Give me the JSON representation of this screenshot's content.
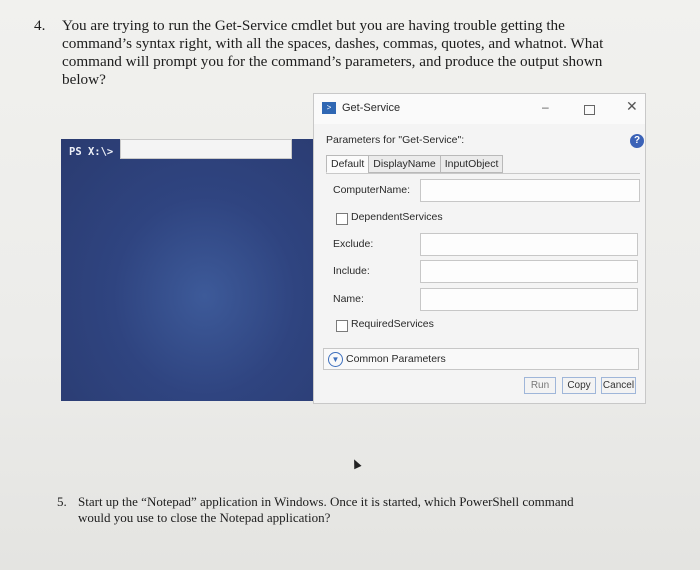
{
  "question4": {
    "number": "4.",
    "text": "You are trying to run the Get-Service cmdlet but you are having trouble getting the command’s syntax right, with all the spaces, dashes, commas, quotes, and whatnot. What command will prompt you for the command’s parameters, and produce the output shown below?"
  },
  "console": {
    "prompt": "PS X:\\>"
  },
  "dialog": {
    "title": "Get-Service",
    "params_heading": "Parameters for \"Get-Service\":",
    "help": "?",
    "tabs": [
      {
        "label": "Default"
      },
      {
        "label": "DisplayName"
      },
      {
        "label": "InputObject"
      }
    ],
    "fields": {
      "computer_name": "ComputerName:",
      "dependent_services": "DependentServices",
      "exclude": "Exclude:",
      "include": "Include:",
      "name": "Name:",
      "required_services": "RequiredServices"
    },
    "common_parameters": "Common Parameters",
    "buttons": {
      "run": "Run",
      "copy": "Copy",
      "cancel": "Cancel"
    },
    "window_controls": {
      "minimize": "–",
      "maximize": "",
      "close": "✕"
    }
  },
  "question5": {
    "number": "5.",
    "text": "Start up the “Notepad” application in Windows. Once it is started, which PowerShell command would you use to close the Notepad application?"
  }
}
